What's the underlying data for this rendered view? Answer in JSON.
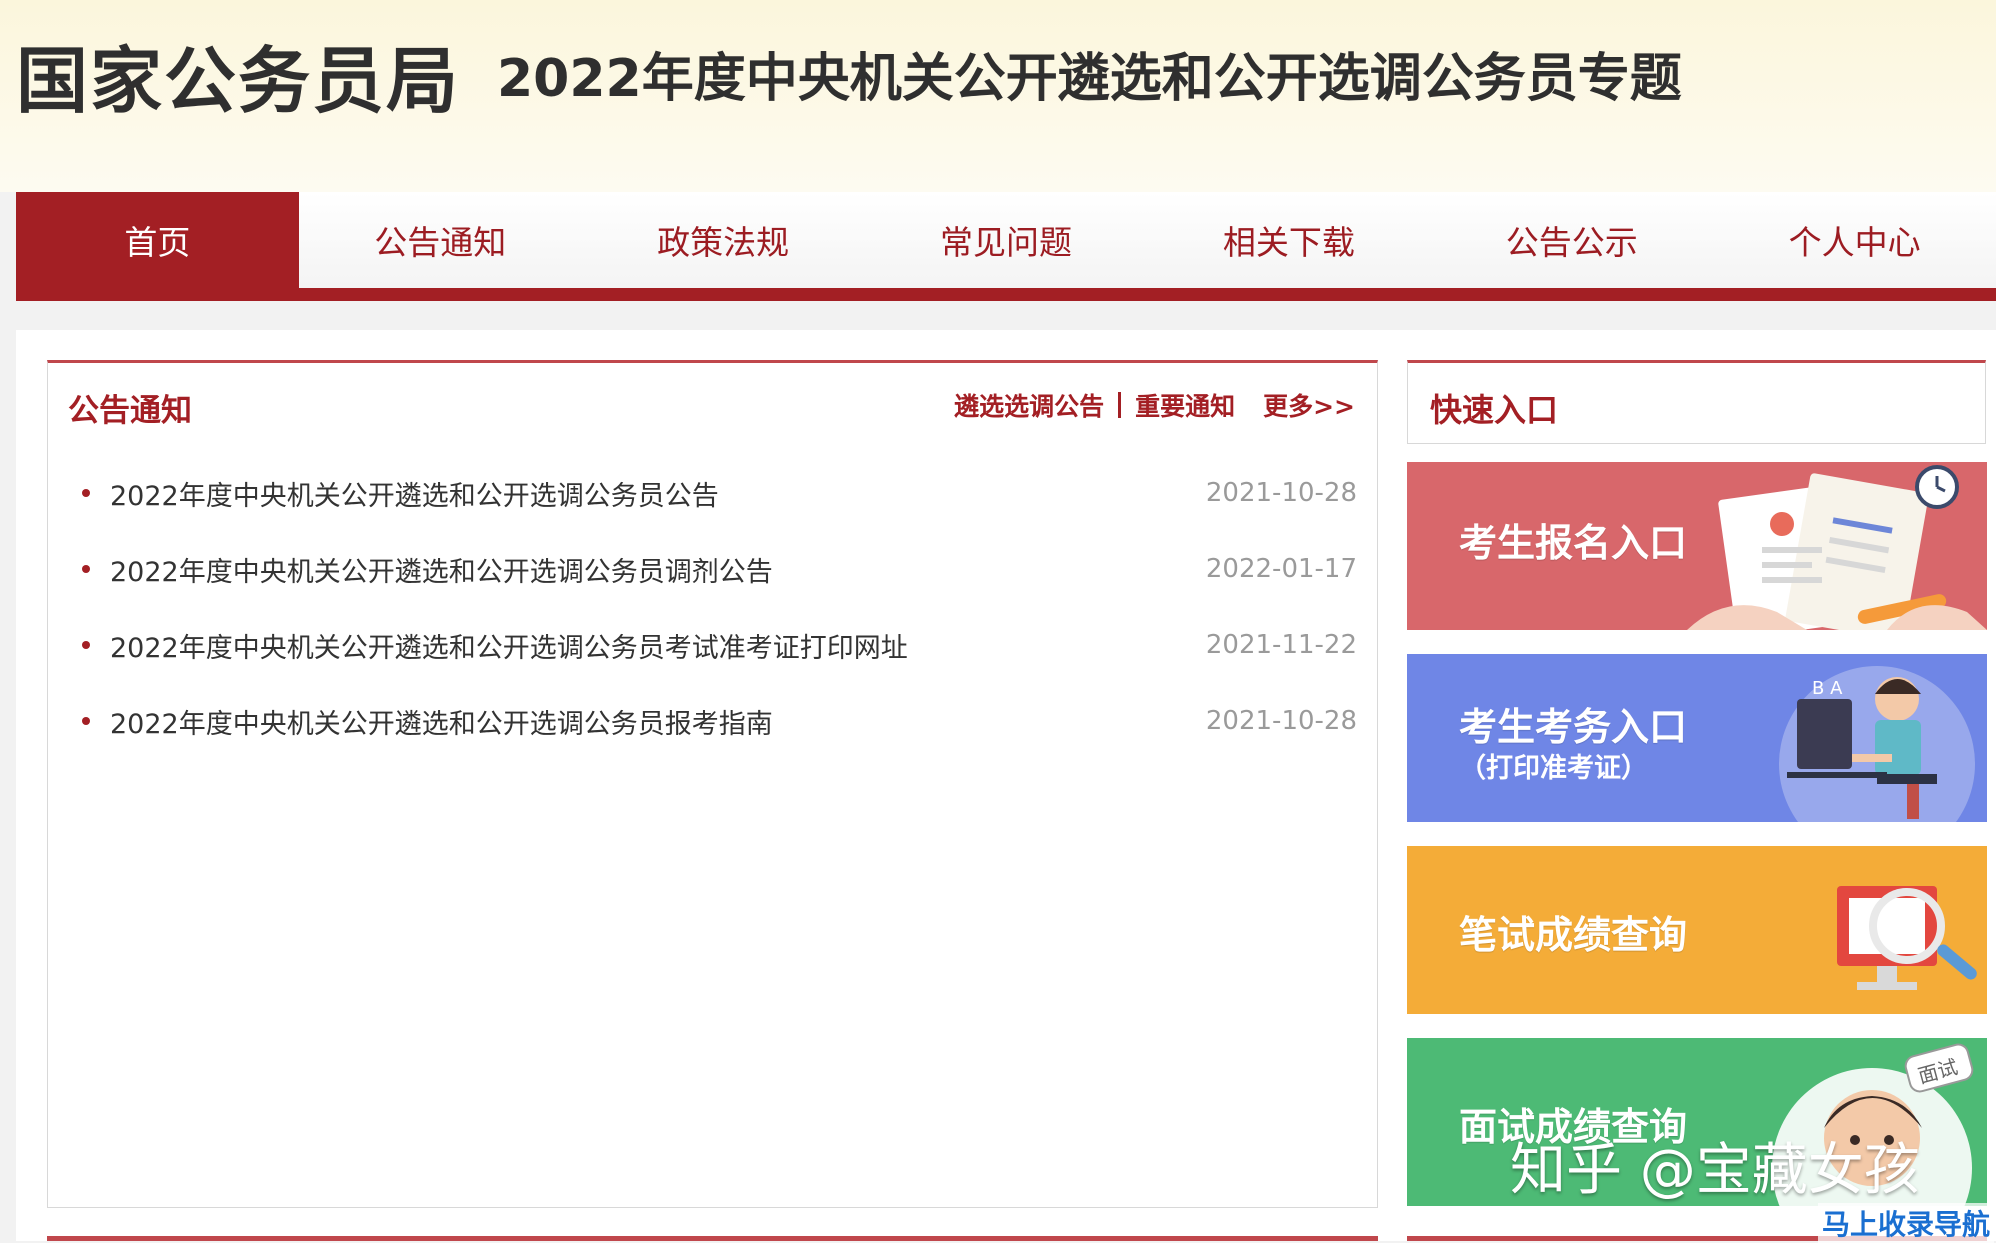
{
  "header": {
    "logo": "国家公务员局",
    "subject": "2022年度中央机关公开遴选和公开选调公务员专题"
  },
  "nav": {
    "items": [
      {
        "label": "首页"
      },
      {
        "label": "公告通知"
      },
      {
        "label": "政策法规"
      },
      {
        "label": "常见问题"
      },
      {
        "label": "相关下载"
      },
      {
        "label": "公告公示"
      },
      {
        "label": "个人中心"
      }
    ],
    "active_index": 0
  },
  "notices": {
    "title": "公告通知",
    "links": {
      "selection": "遴选选调公告",
      "important": "重要通知",
      "more": "更多>>"
    },
    "items": [
      {
        "title": "2022年度中央机关公开遴选和公开选调公务员公告",
        "date": "2021-10-28"
      },
      {
        "title": "2022年度中央机关公开遴选和公开选调公务员调剂公告",
        "date": "2022-01-17"
      },
      {
        "title": "2022年度中央机关公开遴选和公开选调公务员考试准考证打印网址",
        "date": "2021-11-22"
      },
      {
        "title": "2022年度中央机关公开遴选和公开选调公务员报考指南",
        "date": "2021-10-28"
      }
    ]
  },
  "quick": {
    "title": "快速入口",
    "entries": [
      {
        "label": "考生报名入口",
        "sub": "",
        "color": "#d8676b",
        "icon": "application-form-icon"
      },
      {
        "label": "考生考务入口",
        "sub": "（打印准考证）",
        "color": "#6f86e6",
        "icon": "student-computer-icon"
      },
      {
        "label": "笔试成绩查询",
        "sub": "",
        "color": "#f4ac38",
        "icon": "monitor-magnifier-icon"
      },
      {
        "label": "面试成绩查询",
        "sub": "",
        "color": "#4dba75",
        "icon": "interview-person-icon"
      }
    ]
  },
  "watermark": {
    "text": "知乎 @宝藏女孩",
    "corner": "马上收录导航"
  },
  "colors": {
    "brand_red": "#a31f24",
    "header_bg": "#fdf9e8"
  }
}
